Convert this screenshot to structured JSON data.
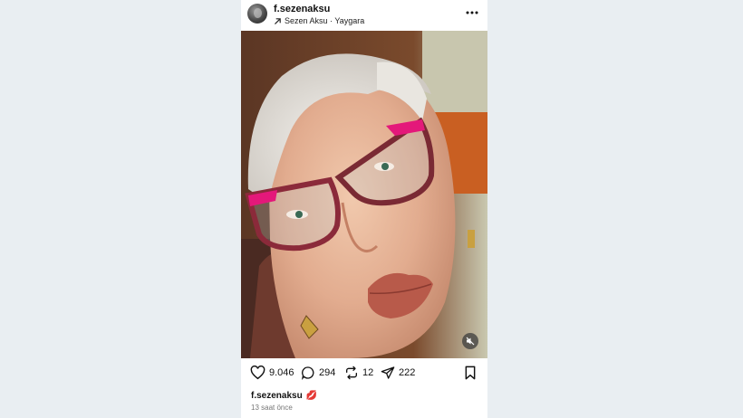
{
  "post": {
    "username": "f.sezenaksu",
    "audio": {
      "label": "Sezen Aksu · Yaygara",
      "icon": "arrow-up-right-icon"
    },
    "more_icon": "more-horizontal-icon",
    "media": {
      "mute_icon": "speaker-muted-icon"
    },
    "actions": {
      "likes": "9.046",
      "comments": "294",
      "reposts": "12",
      "shares": "222",
      "like_icon": "heart-icon",
      "comment_icon": "comment-bubble-icon",
      "repost_icon": "repost-icon",
      "share_icon": "send-icon",
      "save_icon": "bookmark-icon"
    },
    "caption": {
      "user": "f.sezenaksu",
      "emoji": "💋"
    },
    "timestamp": "13 saat önce"
  },
  "colors": {
    "page_background": "#e9eef2",
    "card_background": "#ffffff",
    "text": "#111111",
    "muted_text": "#777777"
  }
}
